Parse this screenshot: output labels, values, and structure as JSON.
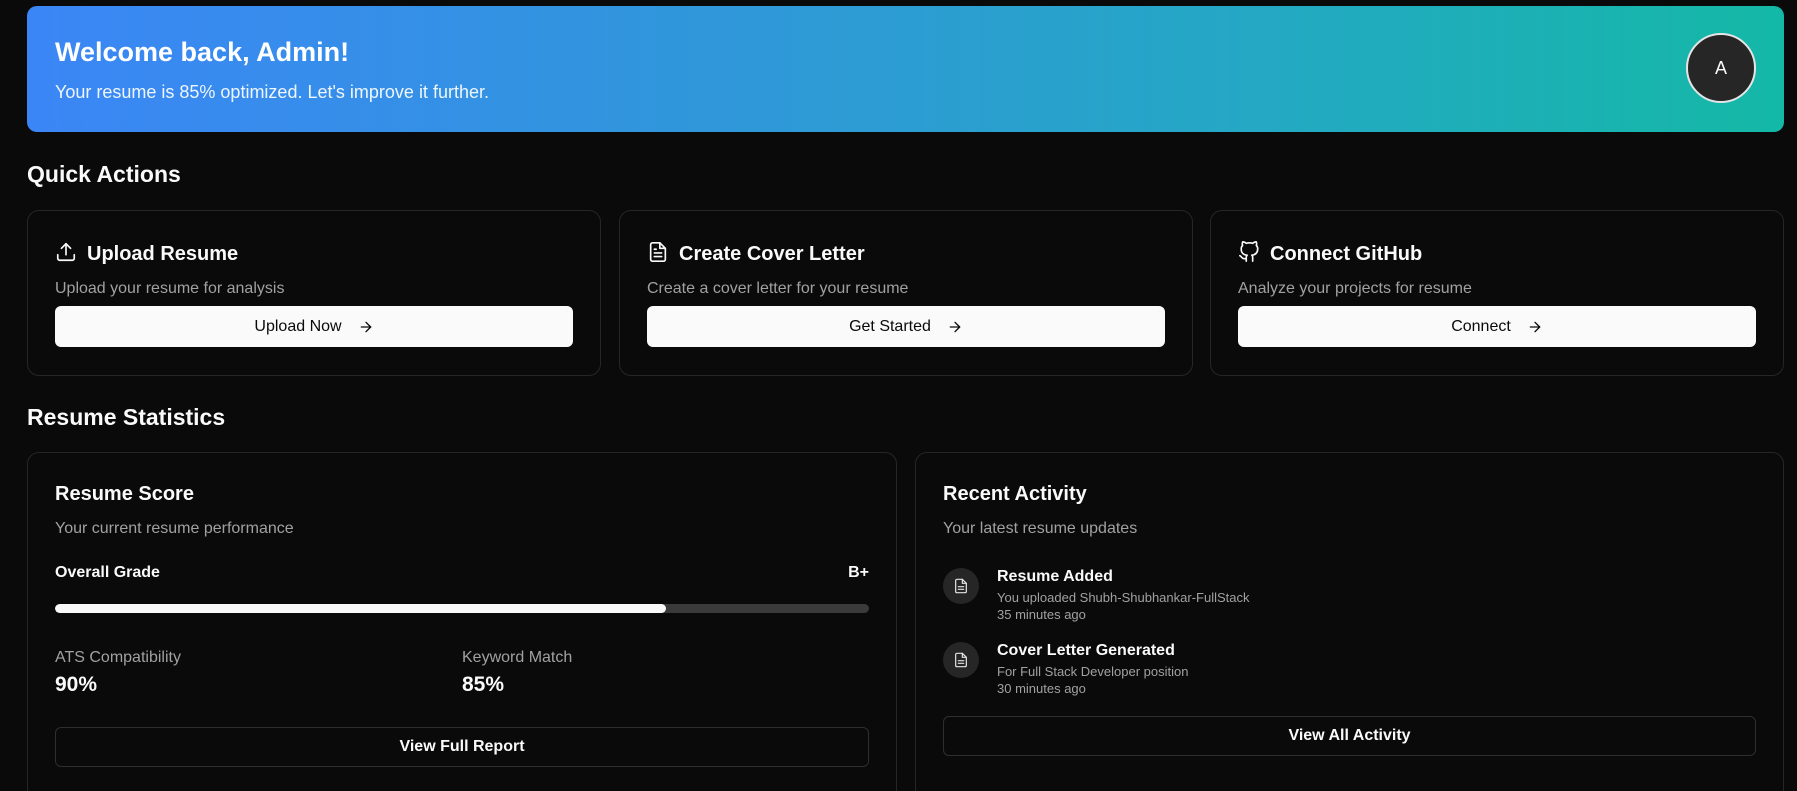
{
  "hero": {
    "title": "Welcome back, Admin!",
    "subtitle": "Your resume is 85% optimized. Let's improve it further.",
    "avatar_initial": "A",
    "gradient_start": "#3b86f6",
    "gradient_end": "#14b8a6"
  },
  "quick_actions": {
    "title": "Quick Actions",
    "items": [
      {
        "icon": "upload-icon",
        "title": "Upload Resume",
        "description": "Upload your resume for analysis",
        "button": "Upload Now"
      },
      {
        "icon": "file-text-icon",
        "title": "Create Cover Letter",
        "description": "Create a cover letter for your resume",
        "button": "Get Started"
      },
      {
        "icon": "github-icon",
        "title": "Connect GitHub",
        "description": "Analyze your projects for resume",
        "button": "Connect"
      }
    ]
  },
  "stats": {
    "title": "Resume Statistics",
    "score": {
      "title": "Resume Score",
      "description": "Your current resume performance",
      "grade_label": "Overall Grade",
      "grade": "B+",
      "progress_percent": 75,
      "ats_label": "ATS Compatibility",
      "ats_value": "90%",
      "keyword_label": "Keyword Match",
      "keyword_value": "85%",
      "button": "View Full Report"
    },
    "activity": {
      "title": "Recent Activity",
      "description": "Your latest resume updates",
      "items": [
        {
          "icon": "file-icon",
          "title": "Resume Added",
          "detail": "You uploaded Shubh-Shubhankar-FullStack",
          "time": "35 minutes ago"
        },
        {
          "icon": "file-icon",
          "title": "Cover Letter Generated",
          "detail": "For Full Stack Developer position",
          "time": "30 minutes ago"
        }
      ],
      "button": "View All Activity"
    }
  }
}
